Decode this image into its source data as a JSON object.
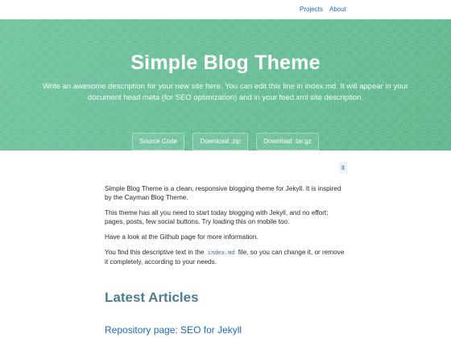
{
  "nav": {
    "projects": "Projects",
    "about": "About"
  },
  "hero": {
    "title": "Simple Blog Theme",
    "description": "Write an awesome description for your new site here. You can edit this line in index.md. It will appear in your document head meta (for SEO optimization) and in your feed.xml site description.",
    "buttons": {
      "source": "Source Code",
      "zip": "Download .zip",
      "tar": "Download .tar.gz"
    }
  },
  "translate_link": "it",
  "content": {
    "p1": "Simple Blog Theme is a clean, responsive blogging theme for Jekyll. It is inspired by the Cayman Blog Theme.",
    "p2": "This theme has all you need to start today blogging with Jekyll, and no effort: pages, posts, few social buttons. Try loading this on mobile too.",
    "p3": "Have a look at the Github page for more information.",
    "p4_before": "You find this descriptive text in the ",
    "p4_code": "index.md",
    "p4_after": " file, so you can change it, or remove it completely, according to your needs."
  },
  "latest_heading": "Latest Articles",
  "article_title": "Repository page: SEO for Jekyll",
  "colors": {
    "hero_bg": "#6cc79a",
    "link": "#1e6bb8",
    "heading": "#4f7c93"
  }
}
